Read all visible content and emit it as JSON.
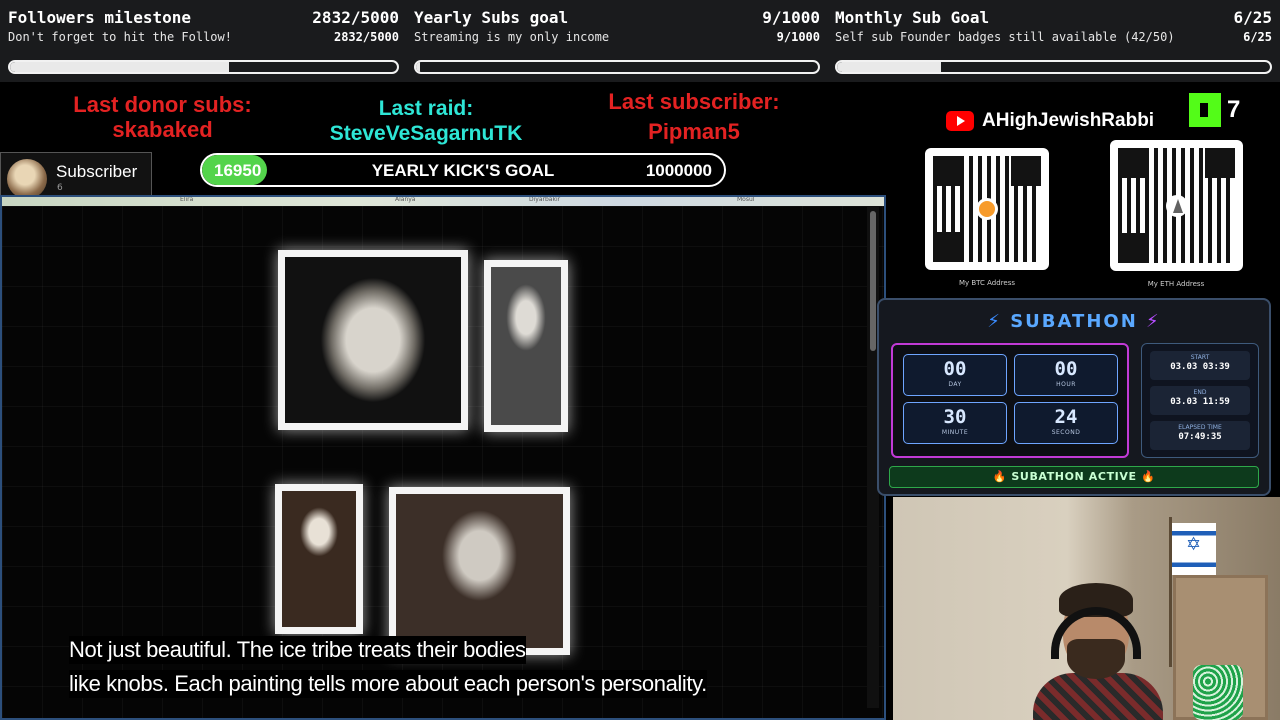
{
  "goals": [
    {
      "title": "Followers milestone",
      "value": "2832/5000",
      "subtitle": "Don't forget to hit the Follow!",
      "subvalue": "2832/5000",
      "progress": 0.5664
    },
    {
      "title": "Yearly Subs goal",
      "value": "9/1000",
      "subtitle": "Streaming is my only income",
      "subvalue": "9/1000",
      "progress": 0.009
    },
    {
      "title": "Monthly Sub Goal",
      "value": "6/25",
      "subtitle": "Self sub Founder badges still available (42/50)",
      "subvalue": "6/25",
      "progress": 0.24
    }
  ],
  "events": {
    "donor_label": "Last donor subs:",
    "donor_name": "skabaked",
    "raid_label": "Last raid:",
    "raid_name": "SteveVeSagarnuTK",
    "sub_label": "Last subscriber:",
    "sub_name": "Pipman5"
  },
  "subscriber_card": {
    "label": "Subscriber",
    "count": "6"
  },
  "kick_goal": {
    "current": "16950",
    "title": "YEARLY KICK'S GOAL",
    "target": "1000000",
    "progress": 0.01695,
    "accent": "#53d44b"
  },
  "video": {
    "map_labels": [
      "Elira",
      "Alanya",
      "Diyarbakir",
      "Mosul"
    ],
    "subtitle_line1": "Not just beautiful. The ice tribe treats their bodies",
    "subtitle_line2": "like knobs. Each painting tells more about each person's personality."
  },
  "channel": {
    "youtube_name": "AHighJewishRabbi",
    "kick_count": "7"
  },
  "crypto": {
    "btc_caption": "My BTC Address",
    "eth_caption": "My ETH Address"
  },
  "subathon": {
    "title": "SUBATHON",
    "tiles": [
      {
        "value": "00",
        "label": "DAY"
      },
      {
        "value": "00",
        "label": "HOUR"
      },
      {
        "value": "30",
        "label": "MINUTE"
      },
      {
        "value": "24",
        "label": "SECOND"
      }
    ],
    "start_label": "START",
    "start_value": "03.03 03:39",
    "end_label": "END",
    "end_value": "03.03 11:59",
    "elapsed_label": "ELAPSED TIME",
    "elapsed_value": "07:49:35",
    "status": "🔥 SUBATHON ACTIVE 🔥",
    "colors": {
      "title": "#5aa8ff",
      "border": "#c13ad6",
      "active": "#2ea84a"
    }
  }
}
